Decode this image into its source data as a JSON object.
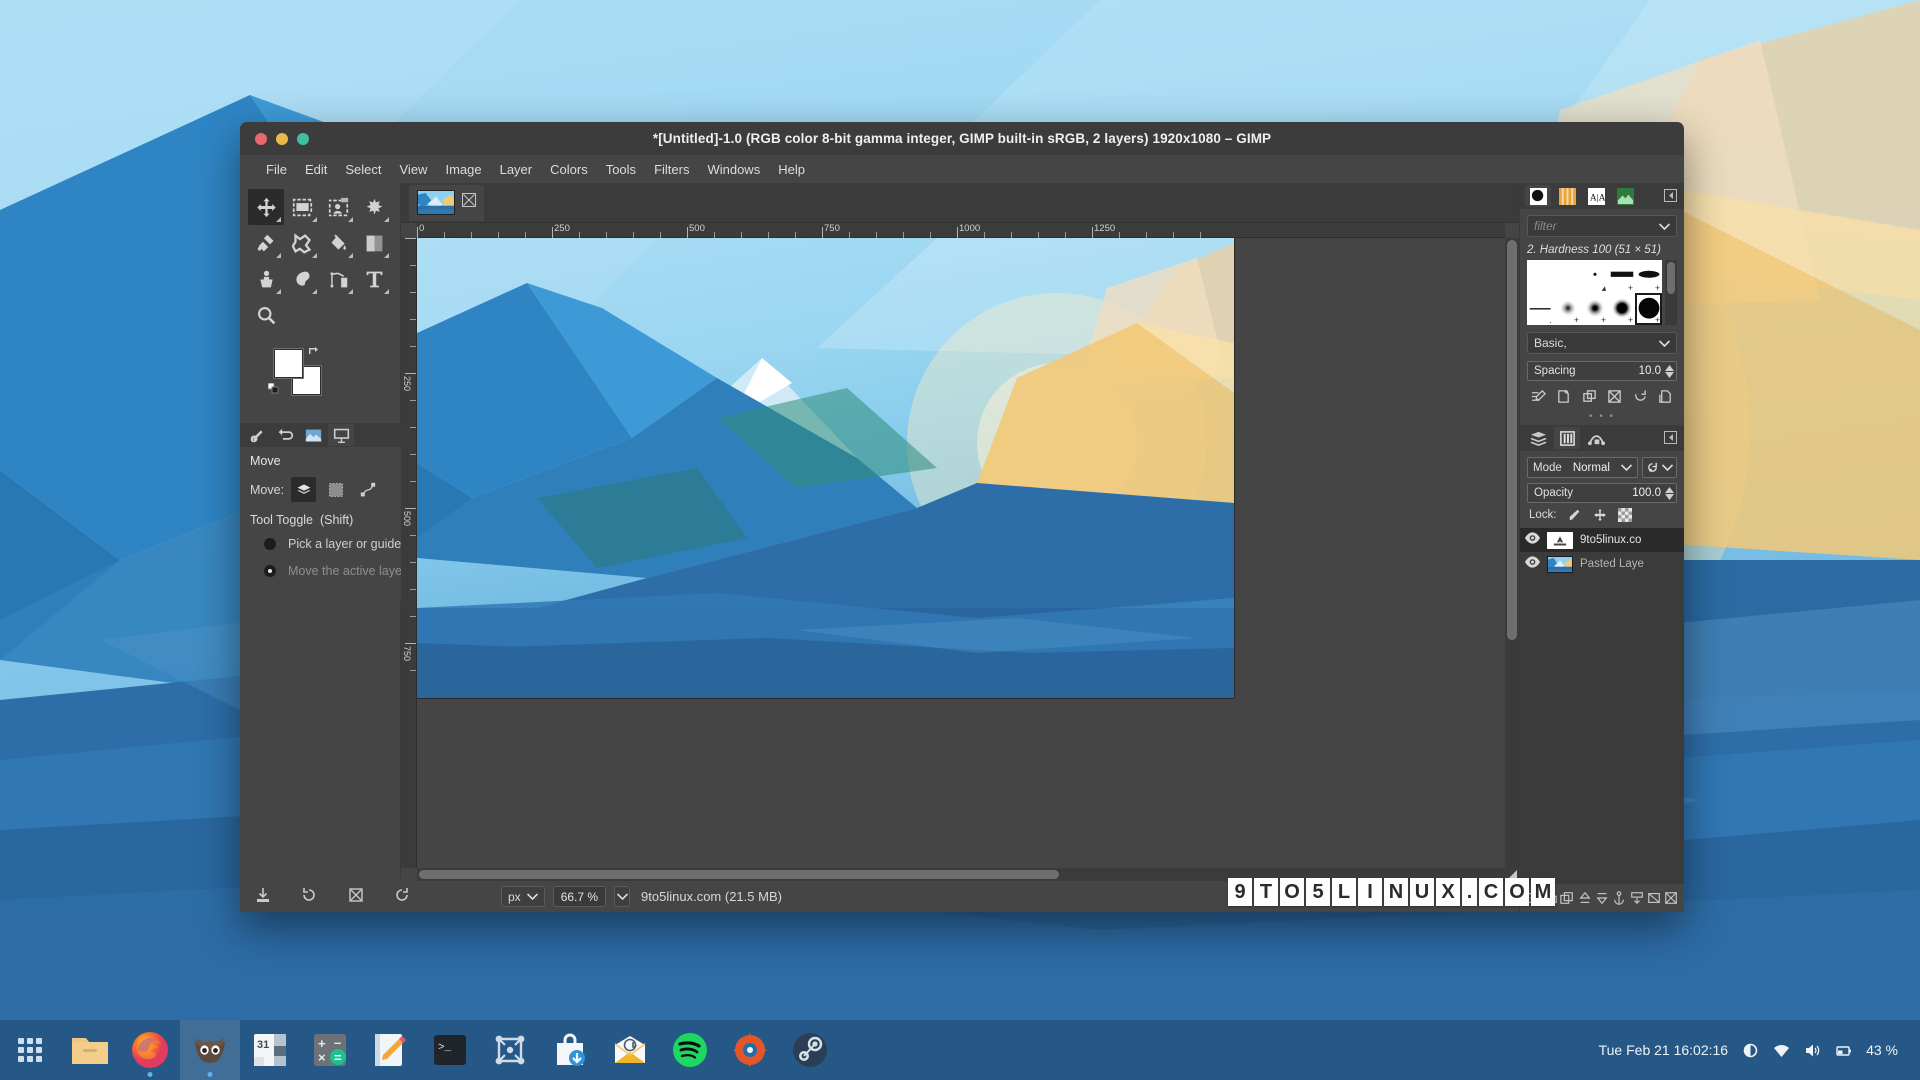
{
  "window": {
    "title": "*[Untitled]-1.0 (RGB color 8-bit gamma integer, GIMP built-in sRGB, 2 layers) 1920x1080 – GIMP",
    "buttons": {
      "close": "close",
      "minimize": "minimize",
      "maximize": "maximize"
    }
  },
  "menubar": {
    "items": [
      {
        "label": "File"
      },
      {
        "label": "Edit"
      },
      {
        "label": "Select"
      },
      {
        "label": "View"
      },
      {
        "label": "Image"
      },
      {
        "label": "Layer"
      },
      {
        "label": "Colors"
      },
      {
        "label": "Tools"
      },
      {
        "label": "Filters"
      },
      {
        "label": "Windows"
      },
      {
        "label": "Help"
      }
    ]
  },
  "toolbox": {
    "tools": [
      {
        "name": "move-tool",
        "icon": "move-icon",
        "active": true
      },
      {
        "name": "rectangle-select-tool",
        "icon": "rect-select-icon",
        "active": false
      },
      {
        "name": "free-select-tool",
        "icon": "free-select-icon",
        "active": false
      },
      {
        "name": "fuzzy-select-tool",
        "icon": "fuzzy-select-icon",
        "active": false
      },
      {
        "name": "warp-transform-tool",
        "icon": "warp-icon",
        "active": false
      },
      {
        "name": "cage-transform-tool",
        "icon": "cage-icon",
        "active": false
      },
      {
        "name": "bucket-fill-tool",
        "icon": "bucket-icon",
        "active": false
      },
      {
        "name": "gradient-tool",
        "icon": "gradient-icon",
        "active": false
      },
      {
        "name": "clone-tool",
        "icon": "clone-icon",
        "active": false
      },
      {
        "name": "smudge-tool",
        "icon": "smudge-icon",
        "active": false
      },
      {
        "name": "paths-tool",
        "icon": "paths-icon",
        "active": false
      },
      {
        "name": "text-tool",
        "icon": "text-icon",
        "active": false
      },
      {
        "name": "zoom-tool",
        "icon": "magnifier-icon",
        "active": false
      }
    ],
    "colors": {
      "foreground": "#ffffff",
      "background": "#ffffff"
    }
  },
  "tool_options": {
    "title": "Move",
    "move_label": "Move:",
    "modes": [
      {
        "name": "move-layer-mode",
        "icon": "layers-icon",
        "selected": true
      },
      {
        "name": "move-selection-mode",
        "icon": "selection-icon",
        "selected": false
      },
      {
        "name": "move-path-mode",
        "icon": "path-icon",
        "selected": false
      }
    ],
    "toggle_label": "Tool Toggle",
    "toggle_shortcut": "(Shift)",
    "radios": [
      {
        "label": "Pick a layer or guide",
        "selected": false
      },
      {
        "label": "Move the active layer",
        "selected": true
      }
    ],
    "tabs": [
      {
        "name": "tool-options-tab",
        "icon": "tool-options-icon"
      },
      {
        "name": "undo-history-tab",
        "icon": "undo-history-icon"
      },
      {
        "name": "images-tab",
        "icon": "images-icon"
      },
      {
        "name": "pointer-tab",
        "icon": "pointer-icon",
        "selected": true
      }
    ],
    "bottom_buttons": [
      "save-options-icon",
      "restore-options-icon",
      "delete-options-icon",
      "reset-options-icon"
    ]
  },
  "image_tab": {
    "name": "9to5linux-image-tab",
    "close": "close-icon"
  },
  "rulers": {
    "horizontal": [
      "0",
      "250",
      "500",
      "750",
      "1000",
      "1250"
    ],
    "vertical": [
      "0",
      "250",
      "500",
      "750"
    ],
    "unit": "px"
  },
  "statusbar": {
    "unit": "px",
    "zoom": "66.7 %",
    "text": "9to5linux.com (21.5 MB)"
  },
  "brushes_panel": {
    "tabs": [
      {
        "name": "brushes-tab",
        "icon": "brush-icon",
        "selected": true
      },
      {
        "name": "patterns-tab",
        "icon": "pattern-icon",
        "selected": false
      },
      {
        "name": "fonts-tab",
        "icon": "font-icon",
        "selected": false
      },
      {
        "name": "document-history-tab",
        "icon": "doc-history-icon",
        "selected": false
      }
    ],
    "filter_placeholder": "filter",
    "selected_brush": "2. Hardness 100 (51 × 51)",
    "tag_filter": "Basic,",
    "spacing_label": "Spacing",
    "spacing_value": "10.0",
    "action_icons": [
      "edit-brush-icon",
      "new-brush-icon",
      "duplicate-brush-icon",
      "delete-brush-icon",
      "refresh-brushes-icon",
      "open-brush-icon"
    ]
  },
  "layers_panel": {
    "tabs": [
      {
        "name": "layers-tab",
        "icon": "layers-icon",
        "selected": false
      },
      {
        "name": "channels-tab",
        "icon": "channels-icon",
        "selected": true
      },
      {
        "name": "paths-tab",
        "icon": "paths-icon",
        "selected": false
      }
    ],
    "mode_label": "Mode",
    "mode_value": "Normal",
    "opacity_label": "Opacity",
    "opacity_value": "100.0",
    "lock_label": "Lock:",
    "lock_icons": [
      "lock-pixels-icon",
      "lock-position-icon",
      "lock-alpha-icon"
    ],
    "layers": [
      {
        "name": "9to5linux.co",
        "selected": true,
        "visible": true,
        "thumb": "text-layer"
      },
      {
        "name": "Pasted Laye",
        "selected": false,
        "visible": true,
        "thumb": "image-layer"
      }
    ],
    "bottom_icons": [
      "new-layer-icon",
      "new-group-icon",
      "duplicate-layer-icon",
      "anchor-layer-icon",
      "merge-down-icon",
      "mask-icon",
      "raise-layer-icon",
      "lower-layer-icon",
      "delete-layer-icon"
    ]
  },
  "watermark": {
    "text": "9TO5LINUX.COM"
  },
  "taskbar": {
    "items": [
      {
        "name": "show-applications",
        "icon": "grid-icon",
        "active": false
      },
      {
        "name": "files-app",
        "icon": "folder-icon",
        "active": false
      },
      {
        "name": "firefox-app",
        "icon": "firefox-icon",
        "active": false,
        "running": true
      },
      {
        "name": "gimp-app",
        "icon": "gimp-wilber-icon",
        "active": true,
        "running": true
      },
      {
        "name": "calendar-app",
        "icon": "calendar-icon",
        "active": false,
        "badge": "31"
      },
      {
        "name": "calculator-app",
        "icon": "calculator-icon",
        "active": false
      },
      {
        "name": "notes-app",
        "icon": "notes-icon",
        "active": false
      },
      {
        "name": "terminal-app",
        "icon": "terminal-icon",
        "active": false
      },
      {
        "name": "settings-app",
        "icon": "nodes-icon",
        "active": false
      },
      {
        "name": "software-app",
        "icon": "software-store-icon",
        "active": false
      },
      {
        "name": "mail-app",
        "icon": "mail-icon",
        "active": false
      },
      {
        "name": "spotify-app",
        "icon": "spotify-icon",
        "active": false
      },
      {
        "name": "kdenlive-app",
        "icon": "kdenlive-icon",
        "active": false
      },
      {
        "name": "steam-app",
        "icon": "steam-icon",
        "active": false
      }
    ],
    "tray": {
      "clock": "Tue Feb 21  16:02:16",
      "icons": [
        "brightness-icon",
        "wifi-icon",
        "volume-icon",
        "battery-icon"
      ],
      "battery": "43 %"
    }
  }
}
